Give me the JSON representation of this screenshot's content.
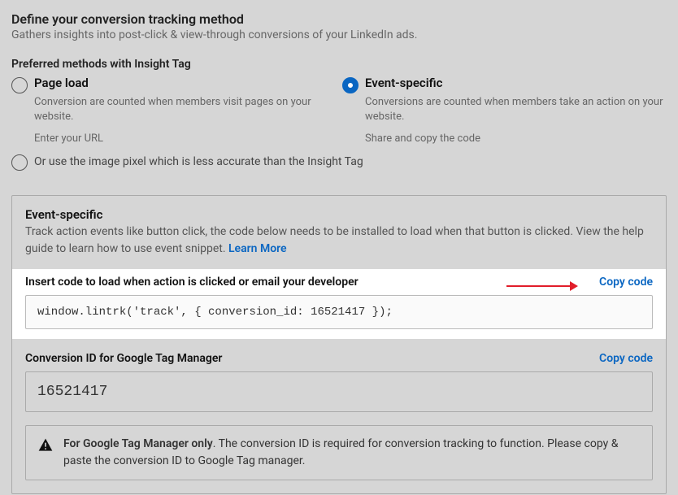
{
  "header": {
    "title": "Define your conversion tracking method",
    "subtitle": "Gathers insights into post-click & view-through conversions of your LinkedIn ads."
  },
  "preferred": {
    "label": "Preferred methods with Insight Tag",
    "page_load": {
      "title": "Page load",
      "desc": "Conversion are counted when members visit pages on your website.",
      "cta": "Enter your URL"
    },
    "event_specific": {
      "title": "Event-specific",
      "desc": "Conversions are counted when members take an action on your website.",
      "cta": "Share and copy the code"
    },
    "alt": "Or use the image pixel which is less accurate than the Insight Tag"
  },
  "event_panel": {
    "title": "Event-specific",
    "desc": "Track action events like button click, the code below needs to be installed to load when that button is clicked. View the help guide to learn how to use event snippet. ",
    "learn_more": "Learn More",
    "insert_label": "Insert code to load when action is clicked or email your developer",
    "copy_code": "Copy code",
    "code": "window.lintrk('track', { conversion_id: 16521417 });"
  },
  "gtm": {
    "label": "Conversion ID for Google Tag Manager",
    "copy_code": "Copy code",
    "id": "16521417",
    "notice_bold": "For Google Tag Manager only",
    "notice_rest": ". The conversion ID is required for conversion tracking to function. Please copy & paste the conversion ID to Google Tag manager."
  }
}
